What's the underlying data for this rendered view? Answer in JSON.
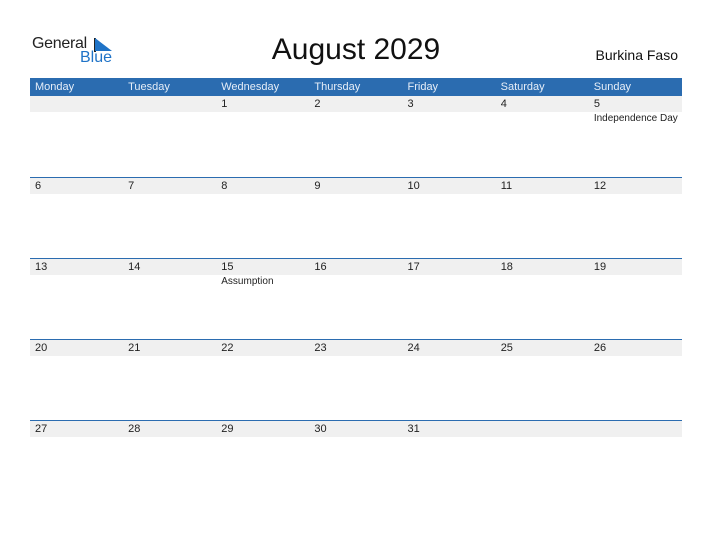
{
  "logo": {
    "word1": "General",
    "word2": "Blue"
  },
  "title": "August 2029",
  "country": "Burkina Faso",
  "colors": {
    "accent": "#2b6cb0",
    "strip": "#f0f0f0",
    "logo_blue": "#1f73c7"
  },
  "weekdays": [
    "Monday",
    "Tuesday",
    "Wednesday",
    "Thursday",
    "Friday",
    "Saturday",
    "Sunday"
  ],
  "weeks": [
    [
      {
        "day": ""
      },
      {
        "day": ""
      },
      {
        "day": "1"
      },
      {
        "day": "2"
      },
      {
        "day": "3"
      },
      {
        "day": "4"
      },
      {
        "day": "5",
        "holiday": "Independence Day"
      }
    ],
    [
      {
        "day": "6"
      },
      {
        "day": "7"
      },
      {
        "day": "8"
      },
      {
        "day": "9"
      },
      {
        "day": "10"
      },
      {
        "day": "11"
      },
      {
        "day": "12"
      }
    ],
    [
      {
        "day": "13"
      },
      {
        "day": "14"
      },
      {
        "day": "15",
        "holiday": "Assumption"
      },
      {
        "day": "16"
      },
      {
        "day": "17"
      },
      {
        "day": "18"
      },
      {
        "day": "19"
      }
    ],
    [
      {
        "day": "20"
      },
      {
        "day": "21"
      },
      {
        "day": "22"
      },
      {
        "day": "23"
      },
      {
        "day": "24"
      },
      {
        "day": "25"
      },
      {
        "day": "26"
      }
    ],
    [
      {
        "day": "27"
      },
      {
        "day": "28"
      },
      {
        "day": "29"
      },
      {
        "day": "30"
      },
      {
        "day": "31"
      },
      {
        "day": ""
      },
      {
        "day": ""
      }
    ]
  ]
}
